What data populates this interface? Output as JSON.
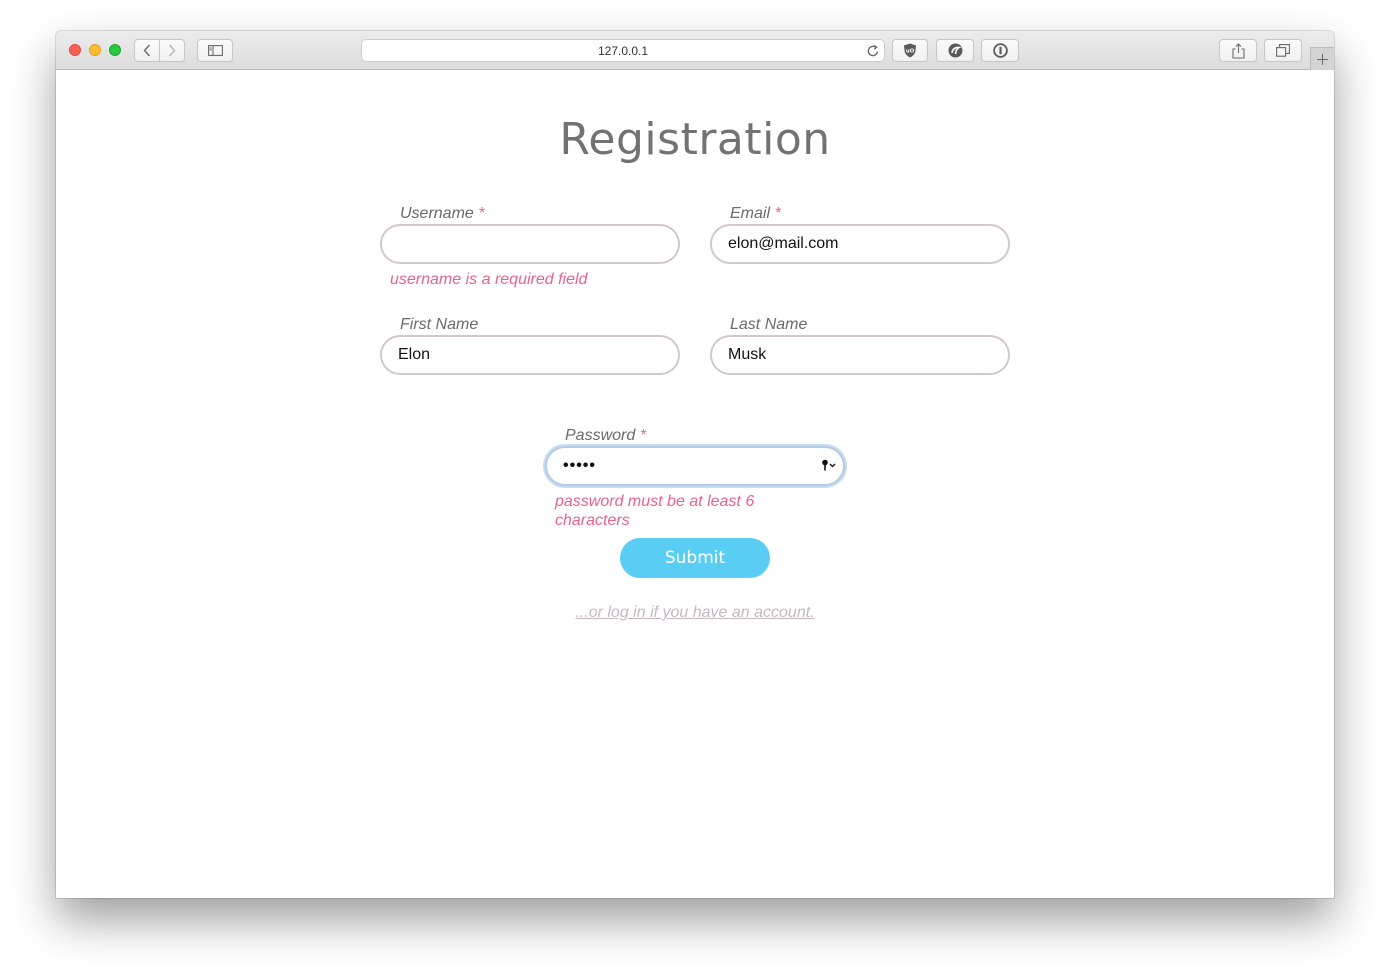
{
  "browser": {
    "url": "127.0.0.1"
  },
  "form": {
    "title": "Registration",
    "fields": {
      "username": {
        "label": "Username",
        "required_mark": "*",
        "value": "",
        "error": "username is a required field"
      },
      "email": {
        "label": "Email",
        "required_mark": "*",
        "value": "elon@mail.com"
      },
      "first_name": {
        "label": "First Name",
        "value": "Elon"
      },
      "last_name": {
        "label": "Last Name",
        "value": "Musk"
      },
      "password": {
        "label": "Password",
        "required_mark": "*",
        "masked_value": "•••••",
        "error_line1": "password must be at least 6",
        "error_line2": "characters"
      }
    },
    "submit_label": "Submit",
    "login_link": "...or log in if you have an account."
  },
  "colors": {
    "error": "#e8628f",
    "button": "#5acdf4",
    "title": "#727272"
  }
}
